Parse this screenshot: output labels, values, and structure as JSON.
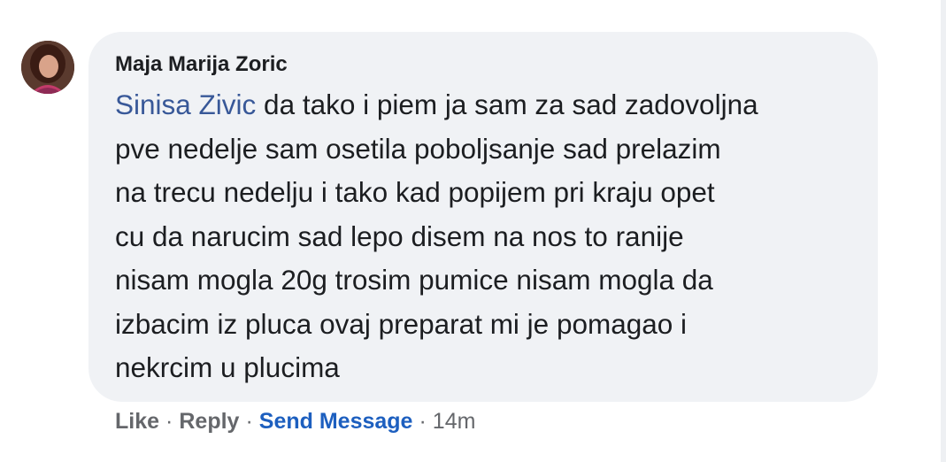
{
  "comment": {
    "author": "Maja Marija Zoric",
    "mention": "Sinisa Zivic",
    "lines": [
      " da tako i piem ja sam za sad zadovoljna",
      "pve nedelje sam osetila poboljsanje sad prelazim",
      "na trecu nedelju i tako kad popijem pri kraju opet",
      "cu da narucim sad lepo disem na nos to ranije",
      "nisam mogla 20g trosim pumice nisam mogla da",
      "izbacim iz pluca ovaj preparat mi je pomagao i",
      "nekrcim u plucima"
    ]
  },
  "actions": {
    "like": "Like",
    "reply": "Reply",
    "send_message": "Send Message",
    "separator": "·",
    "time": "14m"
  },
  "colors": {
    "bubble": "#f0f2f5",
    "mention": "#385898",
    "send_message": "#1d5fbf",
    "meta_text": "#65676b"
  },
  "icons": {
    "avatar": "profile-photo"
  }
}
